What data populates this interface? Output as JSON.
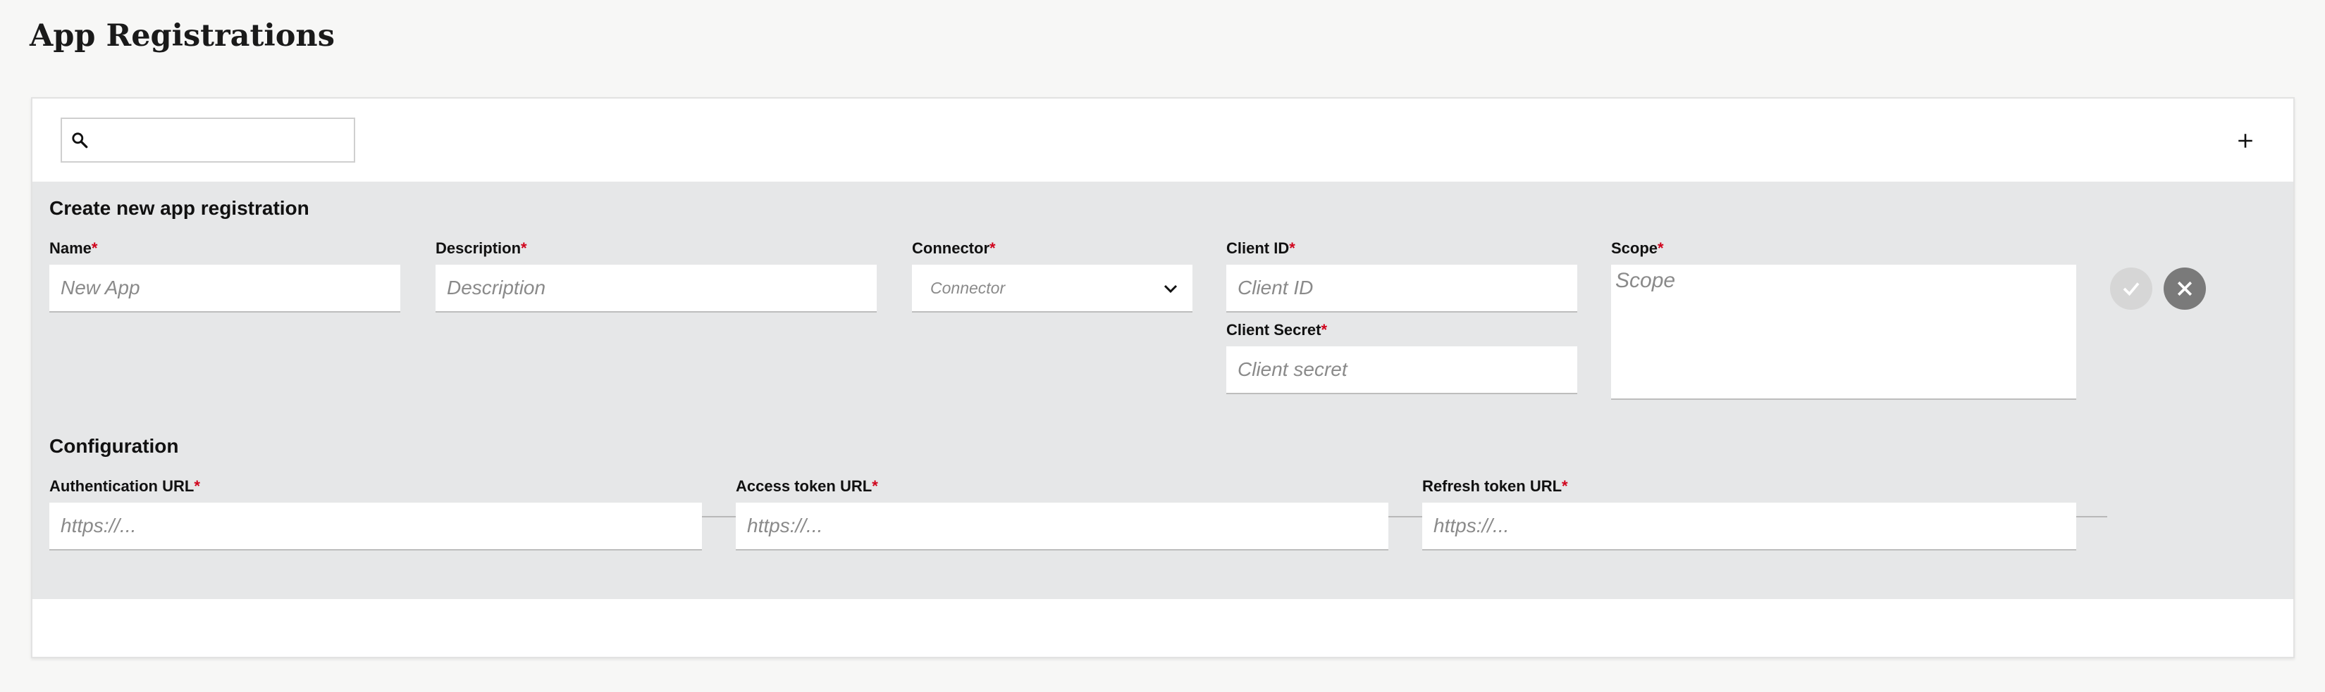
{
  "page": {
    "title": "App Registrations"
  },
  "toolbar": {
    "search_value": "",
    "search_icon": "search-icon",
    "add_icon": "plus-icon"
  },
  "form": {
    "title": "Create new app registration",
    "required_mark": "*",
    "name": {
      "label": "Name",
      "placeholder": "New App"
    },
    "description": {
      "label": "Description",
      "placeholder": "Description"
    },
    "connector": {
      "label": "Connector",
      "placeholder": "Connector"
    },
    "client_id": {
      "label": "Client ID",
      "placeholder": "Client ID"
    },
    "client_secret": {
      "label": "Client Secret",
      "placeholder": "Client secret"
    },
    "scope": {
      "label": "Scope",
      "placeholder": "Scope"
    },
    "confirm_icon": "check-icon",
    "cancel_icon": "close-icon"
  },
  "configuration": {
    "title": "Configuration",
    "auth_url": {
      "label": "Authentication URL",
      "placeholder": "https://..."
    },
    "access_token_url": {
      "label": "Access token URL",
      "placeholder": "https://..."
    },
    "refresh_token_url": {
      "label": "Refresh token URL",
      "placeholder": "https://..."
    }
  },
  "colors": {
    "required": "#d0021b",
    "panel_bg": "#e6e7e8",
    "cancel_button": "#7a7a7a",
    "confirm_button_disabled": "#d6d6d6"
  }
}
